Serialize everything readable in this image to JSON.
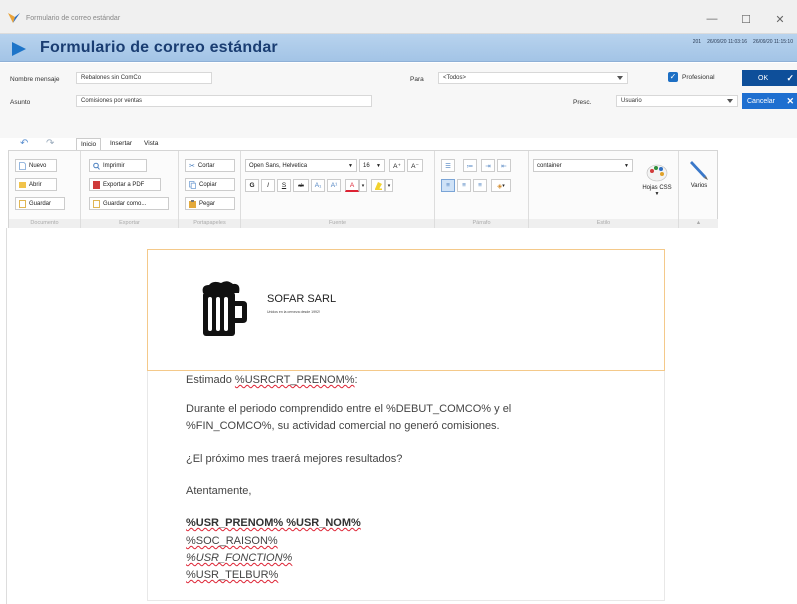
{
  "window": {
    "title": "Formulario de correo estándar",
    "controls": {
      "minimize": "—",
      "maximize": "☐",
      "close": "✕"
    }
  },
  "header": {
    "title": "Formulario de correo estándar",
    "meta": [
      "201",
      "26/09/20 11:03:16",
      "26/09/20 11:15:10"
    ]
  },
  "form": {
    "mensaje_label": "Nombre mensaje",
    "mensaje_value": "Rebalones sin ComCo",
    "para_label": "Para",
    "para_value": "<Todos>",
    "profesional_label": "Profesional",
    "asunto_label": "Asunto",
    "asunto_value": "Comisiones por ventas",
    "presc_label": "Presc.",
    "presc_value": "Usuario",
    "ok_label": "OK",
    "cancel_label": "Cancelar"
  },
  "ribbon": {
    "tabs": [
      "Inicio",
      "Insertar",
      "Vista"
    ],
    "groups": {
      "documento": {
        "label": "Documento",
        "buttons": [
          "Nuevo",
          "Abrir",
          "Guardar"
        ]
      },
      "exportar": {
        "label": "Exportar",
        "buttons": [
          "Imprimir",
          "Exportar a PDF",
          "Guardar como..."
        ]
      },
      "portapapeles": {
        "label": "Portapapeles",
        "buttons": [
          "Cortar",
          "Copiar",
          "Pegar"
        ]
      },
      "fuente": {
        "label": "Fuente",
        "font": "Open Sans, Helvetica",
        "size": "16",
        "grow": "A⁺",
        "shrink": "A⁻",
        "format": [
          "G",
          "I",
          "S",
          "ab",
          "A₁",
          "A¹",
          "A",
          "▾"
        ]
      },
      "parrafo": {
        "label": "Párrafo"
      },
      "estilo": {
        "label": "Estilo",
        "style_value": "container",
        "css_label": "Hojas CSS"
      },
      "varios": {
        "label": "Varios"
      }
    }
  },
  "email": {
    "company": "SOFAR SARL",
    "tagline": "Unidos en la cerveza desde 1992!",
    "greeting": "Estimado %USRCRT_PRENOM%:",
    "line1": "Durante el periodo comprendido entre el %DEBUT_COMCO% y el",
    "line2": "%FIN_COMCO%, su actividad comercial no generó comisiones.",
    "question": "¿El próximo mes traerá mejores resultados?",
    "closing": "Atentamente,",
    "sig_name": "%USR_PRENOM% %USR_NOM%",
    "sig_company": "%SOC_RAISON%",
    "sig_function": "%USR_FONCTION%",
    "sig_phone": "%USR_TELBUR%"
  },
  "colors": {
    "accent": "#1d74c8",
    "header_bg": "#b8d3ee",
    "ok_bg": "#0e4f9a",
    "cancel_bg": "#1e6fd0",
    "head_border": "#f4c98a"
  }
}
